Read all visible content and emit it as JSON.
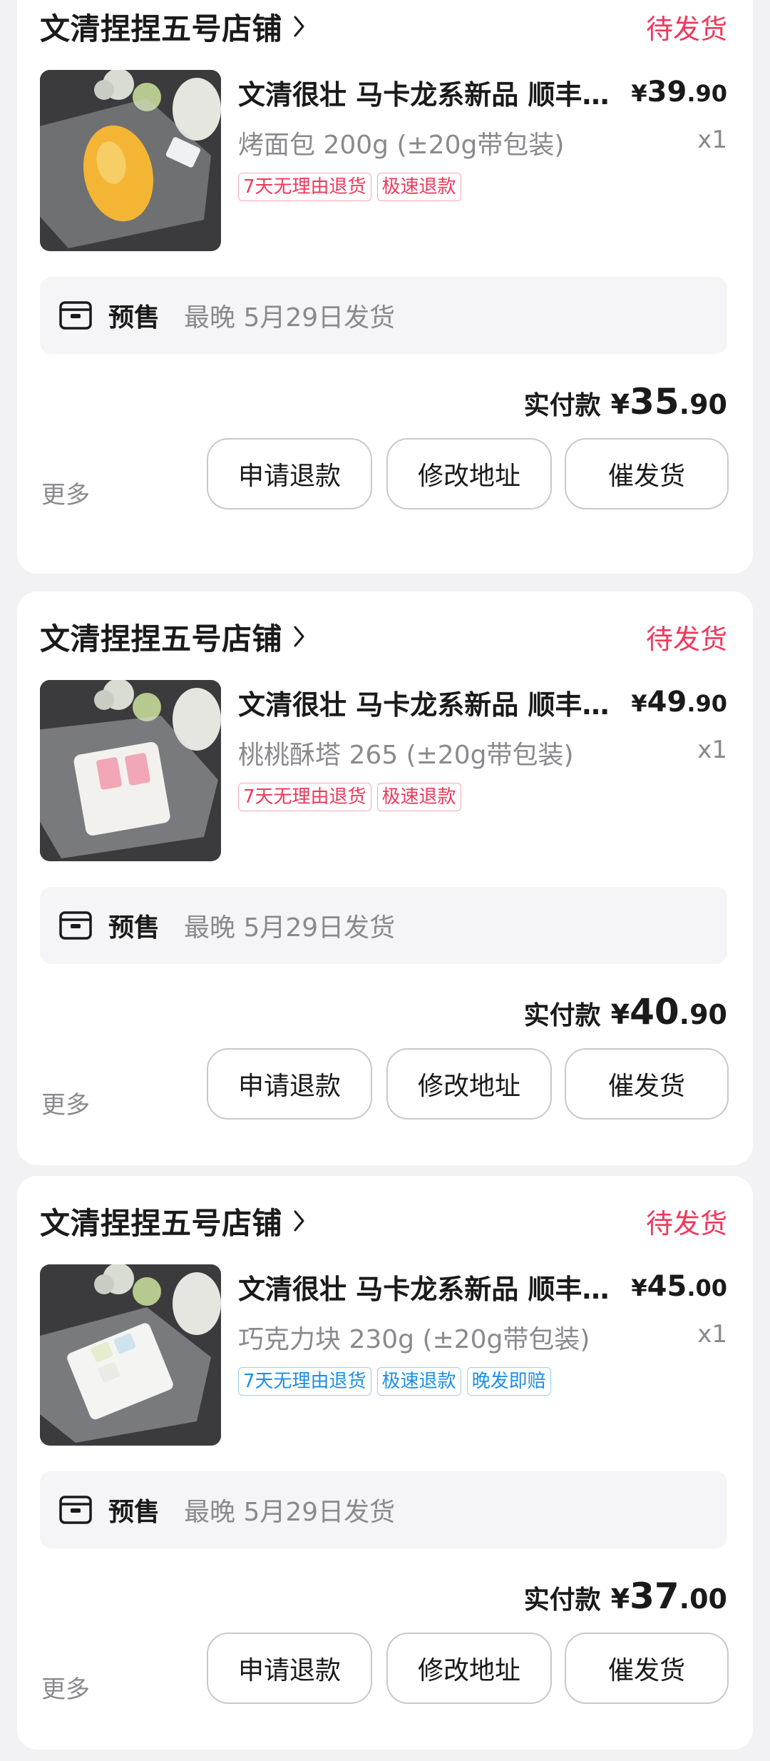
{
  "colors": {
    "accent": "#f0385c",
    "muted": "#8a8a8e",
    "tag_blue": "#1c8ee8"
  },
  "icons": {
    "shop_chevron": "chevron-right-icon",
    "presale": "presale-box-icon"
  },
  "orders": [
    {
      "shop_name": "文清捏捏五号店铺",
      "status": "待发货",
      "title": "文清很壮 马卡龙系新品 顺丰包邮",
      "price": {
        "currency": "¥",
        "integer": "39",
        "decimal": ".90"
      },
      "spec": "烤面包 200g (±20g带包装)",
      "qty": "x1",
      "tags": [
        "7天无理由退货",
        "极速退款"
      ],
      "tag_style": "pink",
      "presale_label": "预售",
      "presale_text": "最晚 5月29日发货",
      "paid_label": "实付款",
      "paid": {
        "currency": "¥",
        "integer": "35",
        "decimal": ".90"
      },
      "more_label": "更多",
      "buttons": {
        "refund": "申请退款",
        "address": "修改地址",
        "urge": "催发货"
      }
    },
    {
      "shop_name": "文清捏捏五号店铺",
      "status": "待发货",
      "title": "文清很壮 马卡龙系新品 顺丰包邮",
      "price": {
        "currency": "¥",
        "integer": "49",
        "decimal": ".90"
      },
      "spec": "桃桃酥塔 265 (±20g带包装)",
      "qty": "x1",
      "tags": [
        "7天无理由退货",
        "极速退款"
      ],
      "tag_style": "pink",
      "presale_label": "预售",
      "presale_text": "最晚 5月29日发货",
      "paid_label": "实付款",
      "paid": {
        "currency": "¥",
        "integer": "40",
        "decimal": ".90"
      },
      "more_label": "更多",
      "buttons": {
        "refund": "申请退款",
        "address": "修改地址",
        "urge": "催发货"
      }
    },
    {
      "shop_name": "文清捏捏五号店铺",
      "status": "待发货",
      "title": "文清很壮 马卡龙系新品 顺丰包邮",
      "price": {
        "currency": "¥",
        "integer": "45",
        "decimal": ".00"
      },
      "spec": "巧克力块 230g (±20g带包装)",
      "qty": "x1",
      "tags": [
        "7天无理由退货",
        "极速退款",
        "晚发即赔"
      ],
      "tag_style": "blue",
      "presale_label": "预售",
      "presale_text": "最晚 5月29日发货",
      "paid_label": "实付款",
      "paid": {
        "currency": "¥",
        "integer": "37",
        "decimal": ".00"
      },
      "more_label": "更多",
      "buttons": {
        "refund": "申请退款",
        "address": "修改地址",
        "urge": "催发货"
      }
    }
  ]
}
